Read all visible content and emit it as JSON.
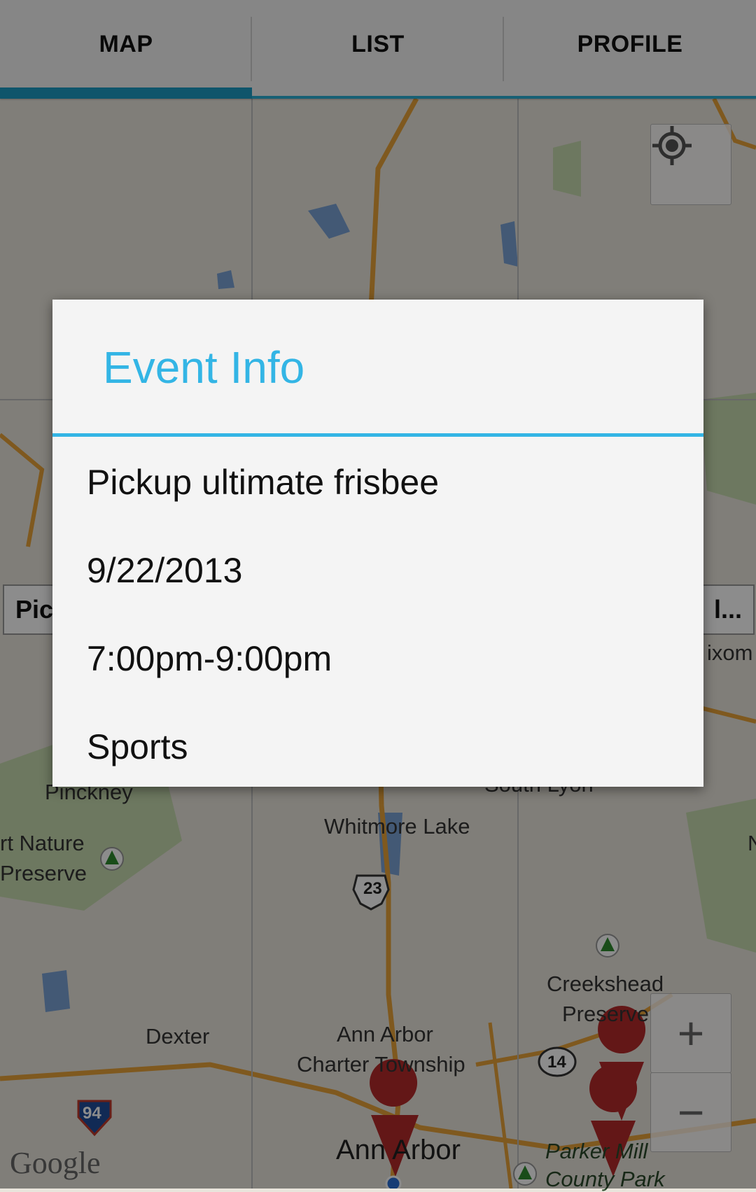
{
  "tabs": [
    {
      "label": "MAP",
      "active": true
    },
    {
      "label": "LIST",
      "active": false
    },
    {
      "label": "PROFILE",
      "active": false
    }
  ],
  "map": {
    "labels": {
      "pinckney": "Pinckney",
      "nature_preserve_1": "rt Nature",
      "nature_preserve_2": "Preserve",
      "whitmore_lake": "Whitmore Lake",
      "south_lyon": "South Lyon",
      "wixom": "ixom",
      "creekshead_1": "Creekshead",
      "creekshead_2": "Preserve",
      "dexter": "Dexter",
      "aa_township_1": "Ann Arbor",
      "aa_township_2": "Charter Township",
      "ann_arbor": "Ann Arbor",
      "parker_mill_1": "Parker Mill",
      "parker_mill_2": "County Park",
      "edge_n": "N"
    },
    "shields": {
      "us23": "23",
      "i94": "94",
      "m14": "14"
    },
    "callout_left": "Pic",
    "callout_right": "l...",
    "attribution": "Google",
    "zoom_in": "+",
    "zoom_out": "−",
    "colors": {
      "road": "#e8a23a",
      "water": "#7aa3d6",
      "park": "#c7dbb0",
      "pin": "#b52a2a"
    }
  },
  "dialog": {
    "title": "Event Info",
    "event_name": "Pickup ultimate frisbee",
    "date": "9/22/2013",
    "time": "7:00pm-9:00pm",
    "category": "Sports",
    "accent": "#33b5e5"
  }
}
